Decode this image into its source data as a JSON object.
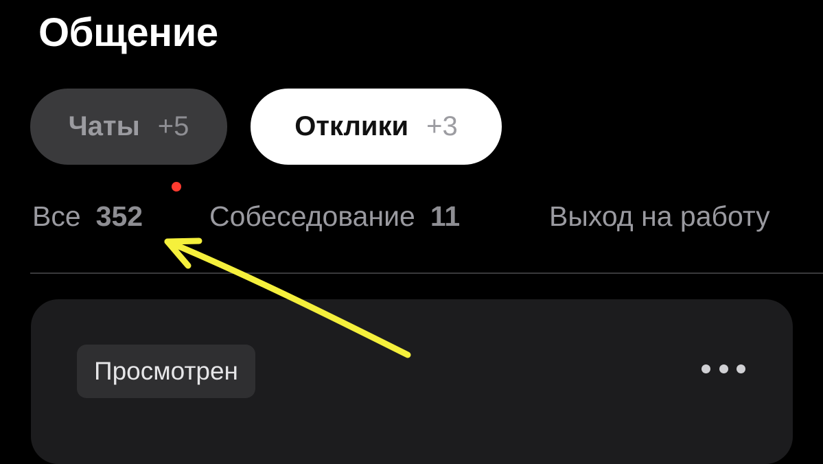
{
  "header": {
    "title": "Общение"
  },
  "segments": [
    {
      "label": "Чаты",
      "count": "+5",
      "selected": false
    },
    {
      "label": "Отклики",
      "count": "+3",
      "selected": true
    }
  ],
  "filters": [
    {
      "label": "Все",
      "count": "352",
      "has_unread_dot": true
    },
    {
      "label": "Собеседование",
      "count": "11"
    },
    {
      "label": "Выход на работу",
      "count": ""
    }
  ],
  "card": {
    "status": "Просмотрен",
    "more_icon": "more-horizontal-icon"
  },
  "annotation": {
    "type": "arrow",
    "color": "#f5f03c"
  },
  "colors": {
    "background": "#000000",
    "accent_dot": "#ff3b30",
    "segment_selected_bg": "#ffffff",
    "segment_bg": "#3a3a3c",
    "card_bg": "#1c1c1e"
  }
}
